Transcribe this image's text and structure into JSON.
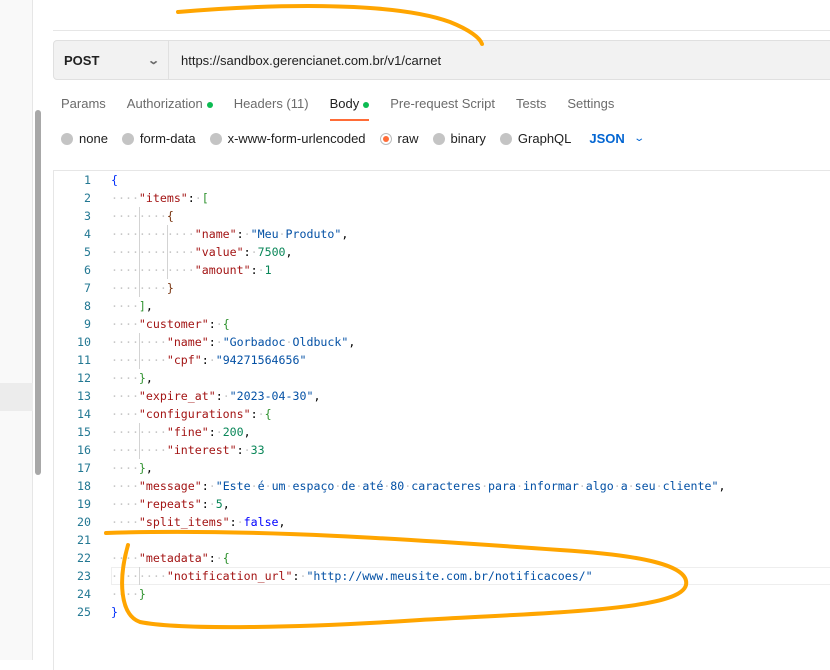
{
  "request": {
    "method": "POST",
    "url": "https://sandbox.gerencianet.com.br/v1/carnet"
  },
  "tabs": [
    {
      "label": "Params",
      "dot": false
    },
    {
      "label": "Authorization",
      "dot": true
    },
    {
      "label": "Headers (11)",
      "dot": false
    },
    {
      "label": "Body",
      "dot": true,
      "active": true
    },
    {
      "label": "Pre-request Script",
      "dot": false
    },
    {
      "label": "Tests",
      "dot": false
    },
    {
      "label": "Settings",
      "dot": false
    }
  ],
  "body_modes": [
    {
      "label": "none"
    },
    {
      "label": "form-data"
    },
    {
      "label": "x-www-form-urlencoded"
    },
    {
      "label": "raw",
      "selected": true
    },
    {
      "label": "binary"
    },
    {
      "label": "GraphQL"
    }
  ],
  "format": "JSON",
  "colors": {
    "accent": "#ff6c37",
    "annotation": "#ffa500",
    "dot": "#0cbb52",
    "json": "#0265d2"
  },
  "code_lines": [
    {
      "indent": 0,
      "tokens": [
        [
          "br1",
          "{"
        ]
      ]
    },
    {
      "indent": 4,
      "tokens": [
        [
          "k",
          "\"items\""
        ],
        [
          "p",
          ": "
        ],
        [
          "br2",
          "["
        ]
      ]
    },
    {
      "indent": 8,
      "tokens": [
        [
          "br3",
          "{"
        ]
      ]
    },
    {
      "indent": 12,
      "tokens": [
        [
          "k",
          "\"name\""
        ],
        [
          "p",
          ": "
        ],
        [
          "s",
          "\"Meu Produto\""
        ],
        [
          "p",
          ","
        ]
      ]
    },
    {
      "indent": 12,
      "tokens": [
        [
          "k",
          "\"value\""
        ],
        [
          "p",
          ": "
        ],
        [
          "n",
          "7500"
        ],
        [
          "p",
          ","
        ]
      ]
    },
    {
      "indent": 12,
      "tokens": [
        [
          "k",
          "\"amount\""
        ],
        [
          "p",
          ": "
        ],
        [
          "n",
          "1"
        ]
      ]
    },
    {
      "indent": 8,
      "tokens": [
        [
          "br3",
          "}"
        ]
      ]
    },
    {
      "indent": 4,
      "tokens": [
        [
          "br2",
          "]"
        ],
        [
          "p",
          ","
        ]
      ]
    },
    {
      "indent": 4,
      "tokens": [
        [
          "k",
          "\"customer\""
        ],
        [
          "p",
          ": "
        ],
        [
          "br2",
          "{"
        ]
      ]
    },
    {
      "indent": 8,
      "tokens": [
        [
          "k",
          "\"name\""
        ],
        [
          "p",
          ": "
        ],
        [
          "s",
          "\"Gorbadoc Oldbuck\""
        ],
        [
          "p",
          ","
        ]
      ]
    },
    {
      "indent": 8,
      "tokens": [
        [
          "k",
          "\"cpf\""
        ],
        [
          "p",
          ": "
        ],
        [
          "s",
          "\"94271564656\""
        ]
      ]
    },
    {
      "indent": 4,
      "tokens": [
        [
          "br2",
          "}"
        ],
        [
          "p",
          ","
        ]
      ]
    },
    {
      "indent": 4,
      "tokens": [
        [
          "k",
          "\"expire_at\""
        ],
        [
          "p",
          ": "
        ],
        [
          "s",
          "\"2023-04-30\""
        ],
        [
          "p",
          ","
        ]
      ]
    },
    {
      "indent": 4,
      "tokens": [
        [
          "k",
          "\"configurations\""
        ],
        [
          "p",
          ": "
        ],
        [
          "br2",
          "{"
        ]
      ]
    },
    {
      "indent": 8,
      "tokens": [
        [
          "k",
          "\"fine\""
        ],
        [
          "p",
          ": "
        ],
        [
          "n",
          "200"
        ],
        [
          "p",
          ","
        ]
      ]
    },
    {
      "indent": 8,
      "tokens": [
        [
          "k",
          "\"interest\""
        ],
        [
          "p",
          ": "
        ],
        [
          "n",
          "33"
        ]
      ]
    },
    {
      "indent": 4,
      "tokens": [
        [
          "br2",
          "}"
        ],
        [
          "p",
          ","
        ]
      ]
    },
    {
      "indent": 4,
      "tokens": [
        [
          "k",
          "\"message\""
        ],
        [
          "p",
          ": "
        ],
        [
          "s",
          "\"Este é um espaço de até 80 caracteres para informar algo a seu cliente\""
        ],
        [
          "p",
          ","
        ]
      ]
    },
    {
      "indent": 4,
      "tokens": [
        [
          "k",
          "\"repeats\""
        ],
        [
          "p",
          ": "
        ],
        [
          "n",
          "5"
        ],
        [
          "p",
          ","
        ]
      ]
    },
    {
      "indent": 4,
      "tokens": [
        [
          "k",
          "\"split_items\""
        ],
        [
          "p",
          ": "
        ],
        [
          "b",
          "false"
        ],
        [
          "p",
          ","
        ]
      ]
    },
    {
      "indent": 0,
      "tokens": []
    },
    {
      "indent": 4,
      "tokens": [
        [
          "k",
          "\"metadata\""
        ],
        [
          "p",
          ": "
        ],
        [
          "br2",
          "{"
        ]
      ]
    },
    {
      "indent": 8,
      "tokens": [
        [
          "k",
          "\"notification_url\""
        ],
        [
          "p",
          ": "
        ],
        [
          "s",
          "\"http://www.meusite.com.br/notificacoes/\""
        ]
      ]
    },
    {
      "indent": 4,
      "tokens": [
        [
          "br2",
          "}"
        ]
      ]
    },
    {
      "indent": 0,
      "tokens": [
        [
          "br1",
          "}"
        ]
      ]
    }
  ]
}
